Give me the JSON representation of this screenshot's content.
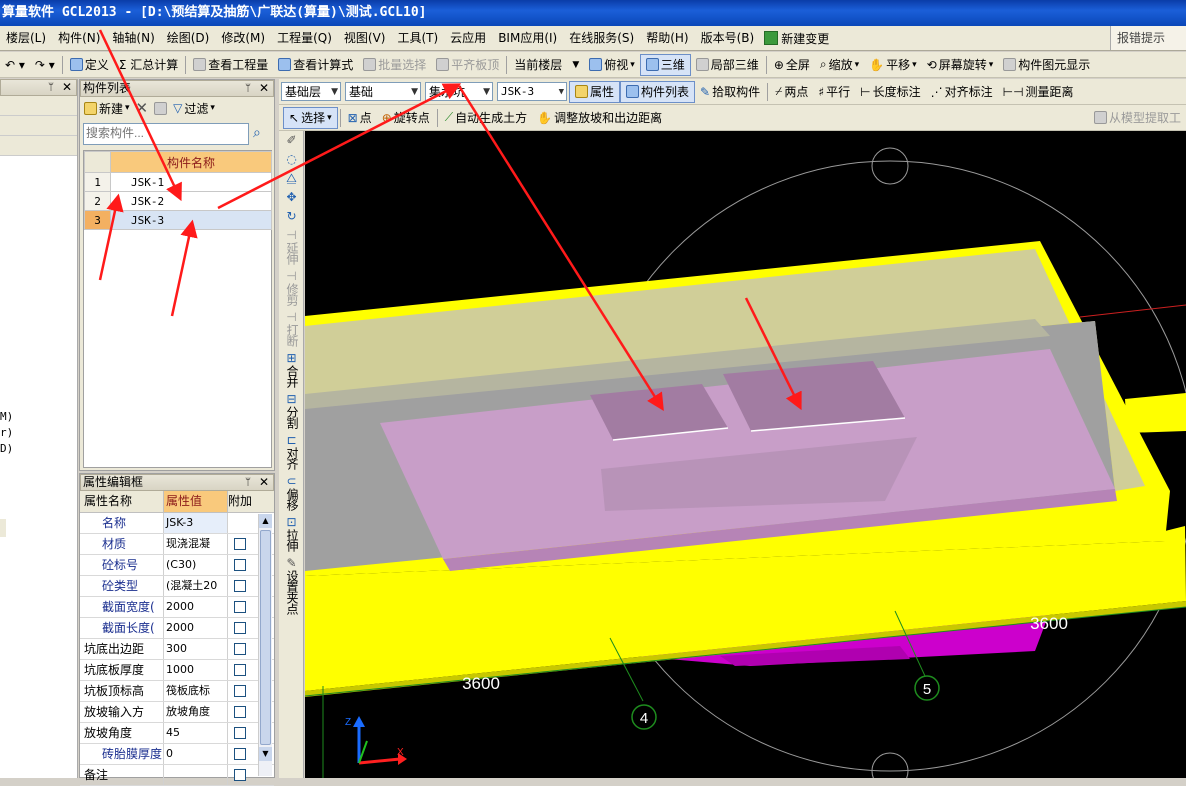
{
  "title": "算量软件 GCL2013 - [D:\\预结算及抽筋\\广联达(算量)\\测试.GCL10]",
  "menu": [
    {
      "label": "楼层(L)"
    },
    {
      "label": "构件(N)"
    },
    {
      "label": "轴轴(N)"
    },
    {
      "label": "绘图(D)"
    },
    {
      "label": "修改(M)"
    },
    {
      "label": "工程量(Q)"
    },
    {
      "label": "视图(V)"
    },
    {
      "label": "工具(T)"
    },
    {
      "label": "云应用"
    },
    {
      "label": "BIM应用(I)"
    },
    {
      "label": "在线服务(S)"
    },
    {
      "label": "帮助(H)"
    },
    {
      "label": "版本号(B)"
    }
  ],
  "menu_new_change": "新建变更",
  "menu_hint": "报错提示",
  "toolbar1": {
    "define": "定义",
    "sum_calc": "Σ 汇总计算",
    "view_qty": "查看工程量",
    "view_formula": "查看计算式",
    "batch_select": "批量选择",
    "level_board": "平齐板顶",
    "current_floor": "当前楼层",
    "top_view": "俯视",
    "three_d": "三维",
    "local_3d": "局部三维",
    "full_screen": "全屏",
    "zoom": "缩放",
    "pan": "平移",
    "screen_rotate": "屏幕旋转",
    "elem_display": "构件图元显示"
  },
  "toolbar2": {
    "floor": "基础层",
    "category": "基础",
    "type": "集水坑",
    "element": "JSK-3",
    "props": "属性",
    "comp_list": "构件列表",
    "pick_comp": "拾取构件",
    "two_points": "两点",
    "parallel": "平行",
    "len_mark": "长度标注",
    "align_mark": "对齐标注",
    "measure": "测量距离"
  },
  "toolbar3": {
    "select": "选择",
    "point": "点",
    "rotate_point": "旋转点",
    "auto_earth": "自动生成土方",
    "adjust_slope": "调整放坡和出边距离",
    "extract_model": "从模型提取工"
  },
  "left_panel": {
    "title": "构件列表",
    "new": "新建",
    "filter": "过滤",
    "search_placeholder": "搜索构件...",
    "col_name": "构件名称",
    "rows": [
      {
        "no": "1",
        "name": "JSK-1"
      },
      {
        "no": "2",
        "name": "JSK-2"
      },
      {
        "no": "3",
        "name": "JSK-3"
      }
    ]
  },
  "far_left": {
    "items": [
      "M)",
      "r)",
      "D)"
    ]
  },
  "props_panel": {
    "title": "属性编辑框",
    "col_name": "属性名称",
    "col_value": "属性值",
    "col_attach": "附加",
    "rows": [
      {
        "name": "名称",
        "value": "JSK-3",
        "blue": true
      },
      {
        "name": "材质",
        "value": "现浇混凝",
        "blue": true
      },
      {
        "name": "砼标号",
        "value": "(C30)",
        "blue": true
      },
      {
        "name": "砼类型",
        "value": "(混凝土20",
        "blue": true
      },
      {
        "name": "截面宽度(",
        "value": "2000",
        "blue": true
      },
      {
        "name": "截面长度(",
        "value": "2000",
        "blue": true
      },
      {
        "name": "坑底出边距",
        "value": "300",
        "blue": false
      },
      {
        "name": "坑底板厚度",
        "value": "1000",
        "blue": false
      },
      {
        "name": "坑板顶标高",
        "value": "筏板底标",
        "blue": false
      },
      {
        "name": "放坡输入方",
        "value": "放坡角度",
        "blue": false
      },
      {
        "name": "放坡角度",
        "value": "45",
        "blue": false
      },
      {
        "name": "砖胎膜厚度",
        "value": "0",
        "blue": true
      },
      {
        "name": "备注",
        "value": "",
        "blue": false
      }
    ]
  },
  "vtools": [
    "延伸",
    "修剪",
    "打断",
    "合并",
    "分割",
    "对齐",
    "偏移",
    "拉伸",
    "设置夹点"
  ],
  "viewport": {
    "dim_left": "3600",
    "dim_right": "3600",
    "axis_4": "4",
    "axis_5": "5"
  },
  "colors": {
    "canvas": "#000000",
    "slab_yellow": "#ffff00",
    "pit_pink": "#c89ec8",
    "magenta": "#cc00cc",
    "annotation_red": "#ff1a1a",
    "grid_green": "#1e8c1e"
  }
}
